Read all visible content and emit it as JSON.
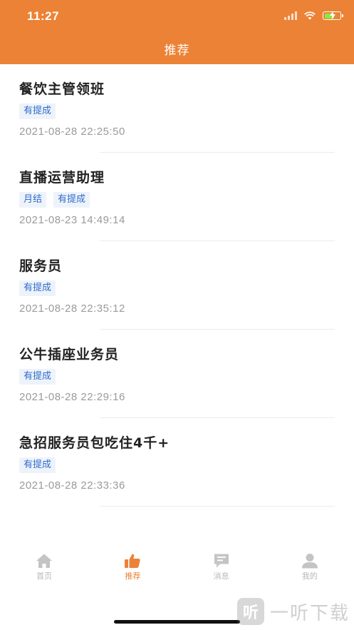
{
  "status_bar": {
    "time": "11:27",
    "icons": [
      "signal-icon",
      "wifi-icon",
      "battery-charging-icon"
    ]
  },
  "nav": {
    "title": "推荐"
  },
  "jobs": [
    {
      "title": "餐饮主管领班",
      "tags": [
        "有提成"
      ],
      "date": "2021-08-28 22:25:50"
    },
    {
      "title": "直播运营助理",
      "tags": [
        "月结",
        "有提成"
      ],
      "date": "2021-08-23 14:49:14"
    },
    {
      "title": "服务员",
      "tags": [
        "有提成"
      ],
      "date": "2021-08-28 22:35:12"
    },
    {
      "title": "公牛插座业务员",
      "tags": [
        "有提成"
      ],
      "date": "2021-08-28 22:29:16"
    },
    {
      "title": "急招服务员包吃住4千+",
      "tags": [
        "有提成"
      ],
      "date": "2021-08-28 22:33:36"
    }
  ],
  "tabbar": {
    "tabs": [
      {
        "label": "首页",
        "icon": "home-icon",
        "active": false
      },
      {
        "label": "推荐",
        "icon": "thumbs-up-icon",
        "active": true
      },
      {
        "label": "消息",
        "icon": "message-icon",
        "active": false
      },
      {
        "label": "我的",
        "icon": "user-icon",
        "active": false
      }
    ]
  },
  "watermark": {
    "logo_char": "听",
    "text": "一听下载"
  },
  "colors": {
    "accent": "#ec8235",
    "tag_text": "#2f6cc9",
    "tag_bg": "#eef3fb",
    "inactive_tab": "#b8b8b8"
  }
}
